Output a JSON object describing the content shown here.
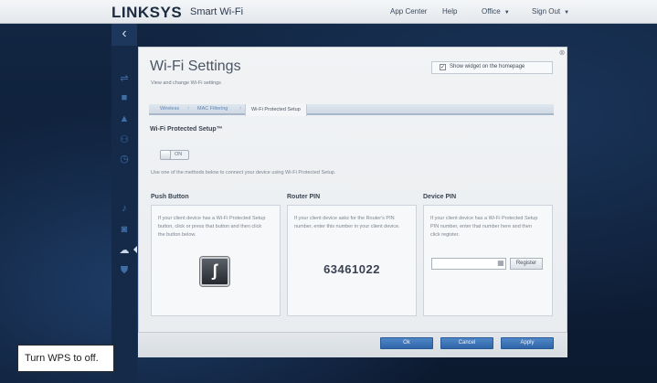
{
  "header": {
    "logo": "LINKSYS",
    "product": "Smart Wi-Fi",
    "nav": [
      {
        "label": "App Center"
      },
      {
        "label": "Help"
      },
      {
        "label": "Office"
      },
      {
        "label": "Sign Out"
      }
    ]
  },
  "sidebar": {
    "back_glyph": "‹",
    "icons": [
      "router-icon",
      "devices-icon",
      "alert-icon",
      "parental-controls-icon",
      "clock-icon",
      "media-icon",
      "camera-icon",
      "wifi-settings-icon",
      "security-icon"
    ]
  },
  "dialog": {
    "title": "Wi-Fi Settings",
    "subtitle": "View and change Wi-Fi settings",
    "show_widget_label": "Show widget on the homepage",
    "show_widget_checked": true,
    "tabs": [
      {
        "label": "Wireless"
      },
      {
        "label": "MAC Filtering"
      },
      {
        "label": "Wi-Fi Protected Setup"
      }
    ],
    "active_tab": "Wi-Fi Protected Setup",
    "section_title": "Wi-Fi Protected Setup™",
    "toggle_state": "ON",
    "instructions": "Use one of the methods below to connect your device using Wi-Fi Protected Setup.",
    "push_button": {
      "heading": "Push Button",
      "text": "If your client device has a Wi-Fi Protected Setup button, click or press that button and then click the button below."
    },
    "router_pin": {
      "heading": "Router PIN",
      "text": "If your client device asks for the Router's PIN number, enter this number in your client device.",
      "pin": "63461022"
    },
    "device_pin": {
      "heading": "Device PIN",
      "text": "If your client device has a Wi-Fi Protected Setup PIN number, enter that number here and then click register.",
      "input_value": "",
      "register_label": "Register"
    },
    "footer": {
      "ok_label": "Ok",
      "cancel_label": "Cancel",
      "apply_label": "Apply"
    }
  },
  "caption": "Turn WPS to off."
}
